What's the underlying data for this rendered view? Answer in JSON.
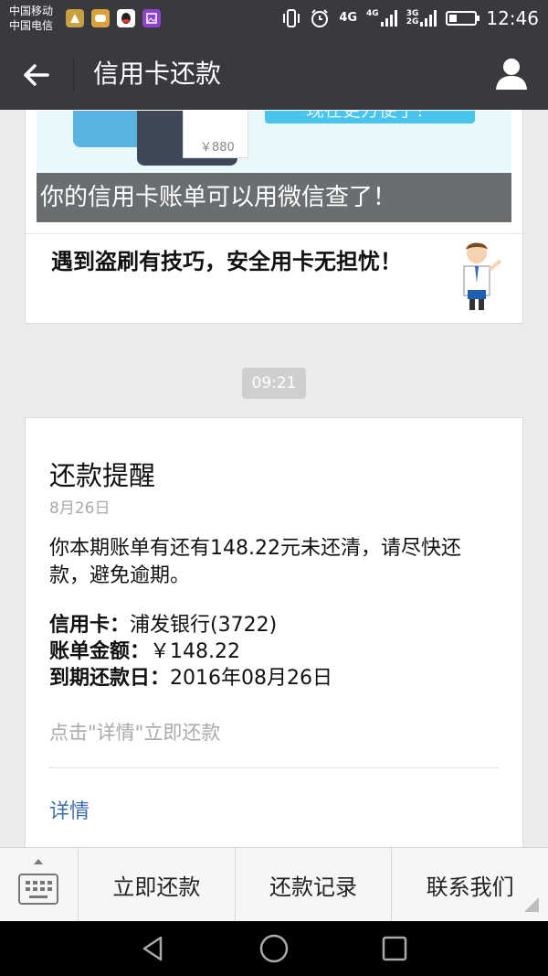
{
  "status_bar": {
    "carrier1": "中国移动",
    "carrier2": "中国电信",
    "net1": "4G",
    "net2": "4G",
    "net3a": "3G",
    "net3b": "2G",
    "time": "12:46"
  },
  "header": {
    "title": "信用卡还款"
  },
  "article_card": {
    "banner_card_amount": "￥880",
    "banner_slogan": "现在更方便了！",
    "banner_caption": "你的信用卡账单可以用微信查了！",
    "item_title": "遇到盗刷有技巧，安全用卡无担忧！"
  },
  "timestamp": "09:21",
  "reminder_card": {
    "title": "还款提醒",
    "date": "8月26日",
    "message": "你本期账单有还有148.22元未还清，请尽快还款，避免逾期。",
    "rows": [
      {
        "label": "信用卡：",
        "value": "浦发银行(3722)"
      },
      {
        "label": "账单金额：",
        "value": "￥148.22"
      },
      {
        "label": "到期还款日：",
        "value": "2016年08月26日"
      }
    ],
    "hint": "点击\"详情\"立即还款",
    "link": "详情"
  },
  "menu": {
    "items": [
      "立即还款",
      "还款记录",
      "联系我们"
    ]
  },
  "colors": {
    "titlebar": "#393a3f",
    "background": "#ebebeb",
    "link": "#3f6ea6"
  }
}
